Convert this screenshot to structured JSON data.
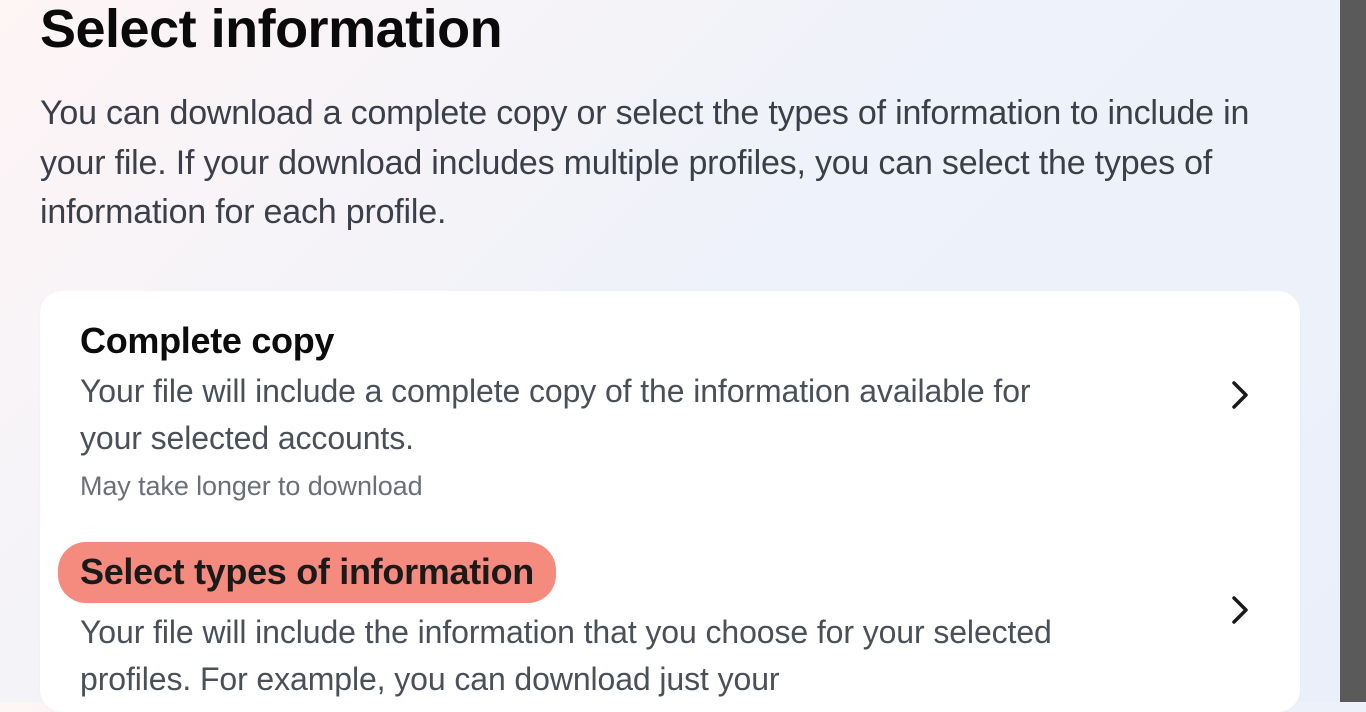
{
  "page": {
    "title": "Select information",
    "description": "You can download a complete copy or select the types of information to include in your file. If your download includes multiple profiles, you can select the types of information for each profile."
  },
  "options": [
    {
      "title": "Complete copy",
      "subtitle": "Your file will include a complete copy of the information available for your selected accounts.",
      "note": "May take longer to download",
      "highlighted": false
    },
    {
      "title": "Select types of information",
      "subtitle": "Your file will include the information that you choose for your selected profiles. For example, you can download just your",
      "note": "",
      "highlighted": true
    }
  ]
}
